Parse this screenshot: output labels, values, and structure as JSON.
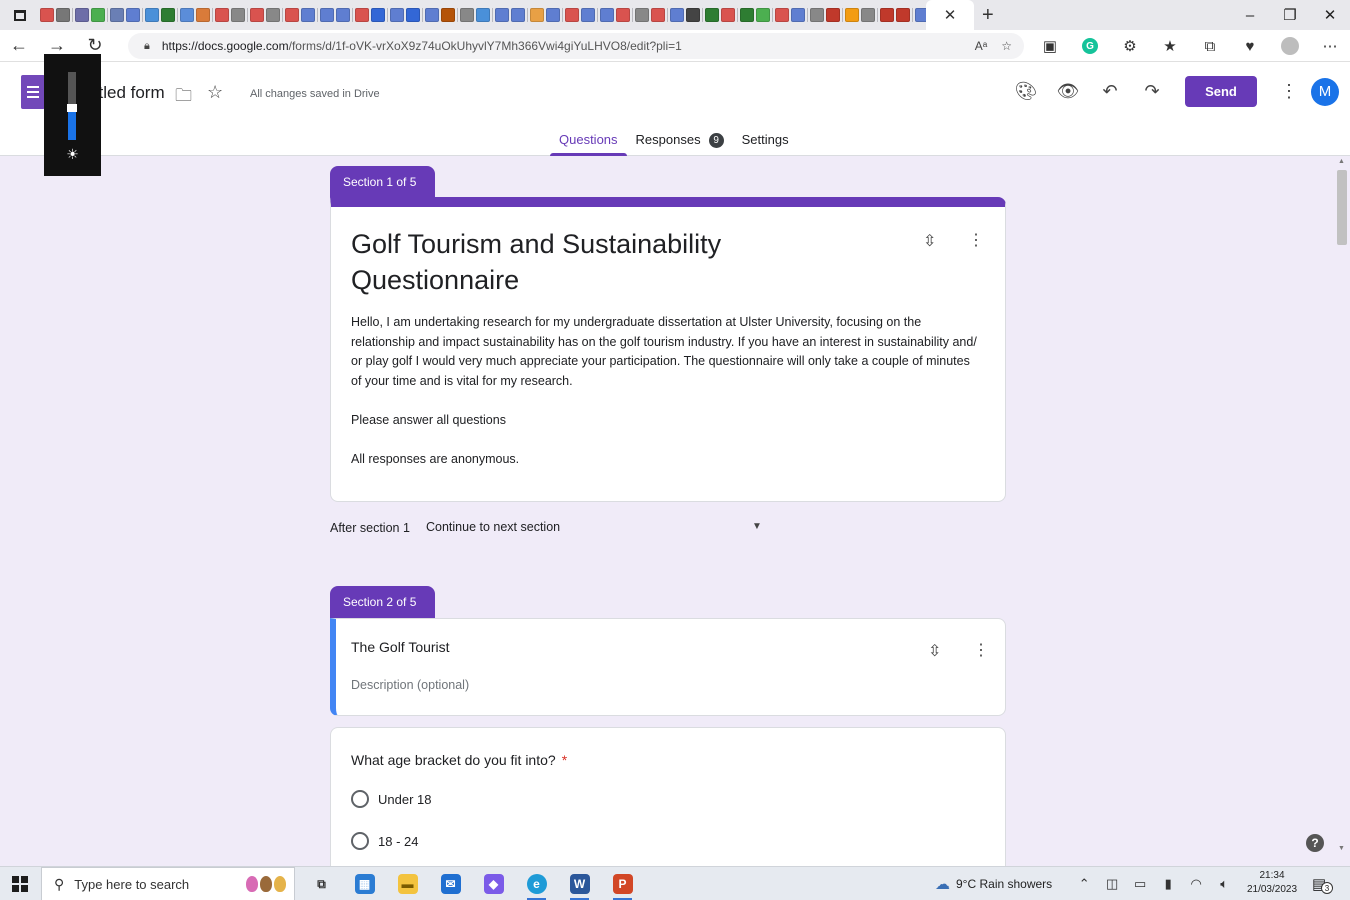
{
  "browser": {
    "tab_favicon_colors": [
      "#d9534f",
      "#777777",
      "#6d6da8",
      "#4caf50",
      "#6a7fb5",
      "#5f7ed1",
      "#4a90d9",
      "#2e7d32",
      "#5b8dd9",
      "#d97b3a",
      "#d9534f",
      "#888888",
      "#d9534f",
      "#888888",
      "#d9534f",
      "#5f7ed1",
      "#5f7ed1",
      "#5f7ed1",
      "#d9534f",
      "#3367d6",
      "#5f7ed1",
      "#3367d6",
      "#5f7ed1",
      "#b45309",
      "#888888",
      "#4a90d9",
      "#5f7ed1",
      "#5f7ed1",
      "#e8a045",
      "#5f7ed1",
      "#d9534f",
      "#5f7ed1",
      "#5f7ed1",
      "#d9534f",
      "#888888",
      "#d9534f",
      "#5f7ed1",
      "#444444",
      "#2e7d32",
      "#d9534f",
      "#2e7d32",
      "#4caf50",
      "#d9534f",
      "#5f7ed1",
      "#888888",
      "#c0392b",
      "#f39c12",
      "#888888",
      "#c0392b",
      "#c0392b",
      "#5f7ed1",
      "#5f7ed1",
      "#666666",
      "#4caf50",
      "#2e7d32",
      "#111111",
      "#888888",
      "#0a66c2"
    ],
    "window_controls": [
      "–",
      "❐",
      "✕"
    ],
    "address": {
      "url_host": "https://docs.google.com",
      "url_path": "/forms/d/1f-oVK-vrXoX9z74uOkUhyvlY7Mh366Vwi4giYuLHVO8/edit?pli=1"
    },
    "icons": {
      "read_aloud": "Aᵃ",
      "grammarly": "G"
    }
  },
  "form_header": {
    "title_visible": "titled form",
    "saved_status": "All changes saved in Drive",
    "send_label": "Send",
    "avatar_initial": "M",
    "tabs": [
      {
        "label": "Questions"
      },
      {
        "label": "Responses",
        "count": "9"
      },
      {
        "label": "Settings"
      }
    ],
    "accent_color": "#673ab7"
  },
  "sections": [
    {
      "tag": "Section 1 of 5",
      "title": "Golf Tourism and Sustainability Questionnaire",
      "description": [
        "Hello, I am undertaking research for my undergraduate dissertation at Ulster University, focusing on the relationship and impact sustainability has on the golf tourism industry. If you have an interest in sustainability and/ or play golf I would very much appreciate your participation. The questionnaire will only take a couple of minutes of your time and is vital for my research.",
        "Please answer all questions",
        "All responses are anonymous."
      ],
      "after_label": "After section 1",
      "after_value": "Continue to next section"
    },
    {
      "tag": "Section 2 of 5",
      "title": "The Golf Tourist",
      "description_placeholder": "Description (optional)"
    }
  ],
  "question": {
    "text": "What age bracket do you fit into?",
    "required_mark": "*",
    "options": [
      "Under 18",
      "18 - 24"
    ]
  },
  "taskbar": {
    "search_placeholder": "Type here to search",
    "weather": "9°C  Rain showers",
    "time": "21:34",
    "date": "21/03/2023",
    "notification_count": "3",
    "apps": [
      {
        "name": "task-view",
        "running": false
      },
      {
        "name": "microsoft-store",
        "running": false
      },
      {
        "name": "file-explorer",
        "running": false
      },
      {
        "name": "mail",
        "running": false
      },
      {
        "name": "copilot-app",
        "running": false
      },
      {
        "name": "edge",
        "running": true
      },
      {
        "name": "word",
        "label": "W",
        "running": true
      },
      {
        "name": "powerpoint",
        "label": "P",
        "running": true
      }
    ]
  }
}
